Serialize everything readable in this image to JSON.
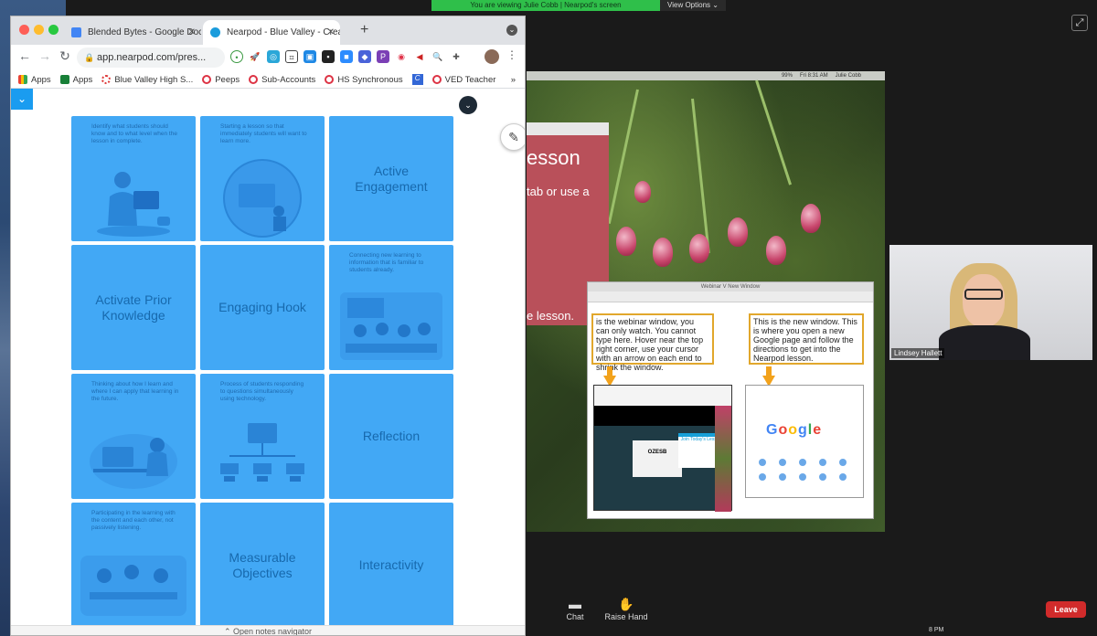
{
  "zoom": {
    "share_banner": "You are viewing Julie Cobb | Nearpod's screen",
    "view_options": "View Options ⌄",
    "participant_name": "Lindsey Hallett",
    "toolbar": {
      "chat_label": "Chat",
      "raise_hand_label": "Raise Hand",
      "leave_label": "Leave"
    },
    "clock_fragment": "8 PM"
  },
  "shared_screen": {
    "menu_bar": {
      "battery": "99%",
      "time": "Fri 8:31 AM",
      "user": "Julie Cobb"
    },
    "lesson_slide": {
      "title": "esson",
      "line1": "tab or use a",
      "line2": "e lesson."
    },
    "webinar_window": {
      "title": "Webinar V New Window",
      "left_note": "is the webinar window,  you can only watch. You cannot type here. Hover near the top right corner, use your cursor with an arrow on each end to shrink the window.",
      "right_note": "This is the new window. This is where you open a new Google page and follow the directions to get into the Nearpod lesson.",
      "join_code": "OZESB",
      "join_card_title": "Join Today's Lesson",
      "google_letters": [
        "G",
        "o",
        "o",
        "g",
        "l",
        "e"
      ]
    }
  },
  "browser": {
    "tabs": [
      {
        "label": "Blended Bytes - Google Docs"
      },
      {
        "label": "Nearpod - Blue Valley - Creatin"
      }
    ],
    "url": "app.nearpod.com/pres...",
    "bookmarks": [
      {
        "label": "Apps",
        "icon": "apps-grid-icon"
      },
      {
        "label": "Apps",
        "icon": "sheets-icon"
      },
      {
        "label": "Blue Valley High S...",
        "icon": "school-icon"
      },
      {
        "label": "Peeps",
        "icon": "ring-icon"
      },
      {
        "label": "Sub-Accounts",
        "icon": "ring-icon"
      },
      {
        "label": "HS Synchronous",
        "icon": "ring-icon"
      },
      {
        "label": "",
        "icon": "c-icon"
      },
      {
        "label": "VED Teacher",
        "icon": "ring-icon"
      }
    ],
    "bookmarks_more": "»"
  },
  "nearpod": {
    "accent_color": "#42a8f5",
    "tiles": [
      {
        "title": "",
        "desc": "Identify what students should know and to what level when the lesson in complete.",
        "illustration": "student-laptop"
      },
      {
        "title": "",
        "desc": "Starting a lesson so that immediately students will want to learn more.",
        "illustration": "globe-people"
      },
      {
        "title": "Active Engagement",
        "desc": ""
      },
      {
        "title": "Activate Prior Knowledge",
        "desc": ""
      },
      {
        "title": "Engaging Hook",
        "desc": ""
      },
      {
        "title": "",
        "desc": "Connecting new learning to information that is familiar to students already.",
        "illustration": "classroom"
      },
      {
        "title": "",
        "desc": "Thinking about how I learn and where I can apply that learning in the future.",
        "illustration": "desk-computer"
      },
      {
        "title": "",
        "desc": "Process of students responding to questions simultaneously using technology.",
        "illustration": "network"
      },
      {
        "title": "Reflection",
        "desc": ""
      },
      {
        "title": "",
        "desc": "Participating in the learning with the content and each other, not passively listening.",
        "illustration": "group-table"
      },
      {
        "title": "Measurable Objectives",
        "desc": ""
      },
      {
        "title": "Interactivity",
        "desc": ""
      }
    ],
    "footer": "⌃ Open notes navigator"
  }
}
